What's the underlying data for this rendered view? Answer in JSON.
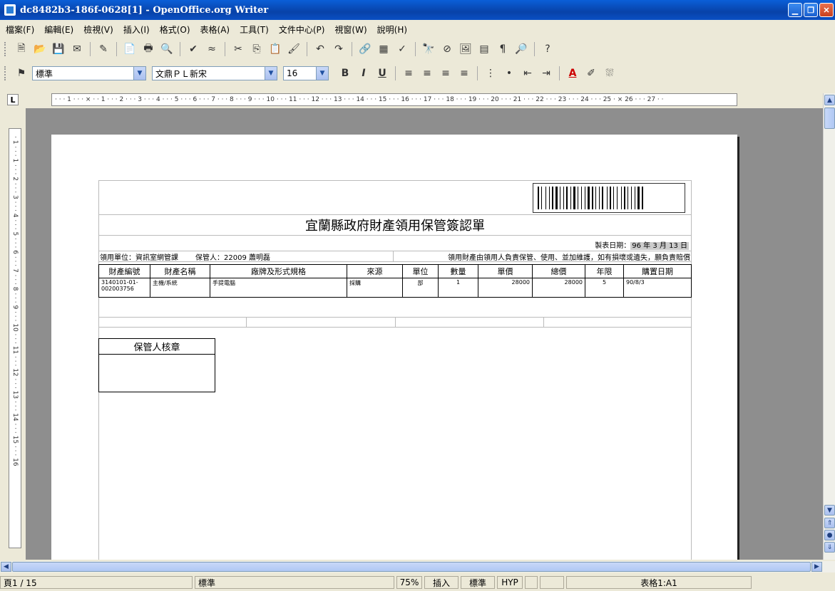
{
  "window": {
    "title": "dc8482b3-186f-0628[1] - OpenOffice.org Writer",
    "controls": [
      "minimize",
      "maximize",
      "close"
    ]
  },
  "menu": [
    "檔案(F)",
    "編輯(E)",
    "檢視(V)",
    "插入(I)",
    "格式(O)",
    "表格(A)",
    "工具(T)",
    "文件中心(P)",
    "視窗(W)",
    "說明(H)"
  ],
  "formatting": {
    "style": "標準",
    "font": "文鼎ＰＬ新宋",
    "size": "16"
  },
  "ruler": {
    "horizontal": "· · · 1 · · · ⨯ · · 1 · · · 2 · · · 3 · · · 4 · · · 5 · · · 6 · · · 7 · · · 8 · · · 9 · · · 10 · · · 11 · · · 12 · · · 13 · · · 14 · · · 15 · · · 16 · · · 17 · · · 18 · · · 19 · · · 20 · · · 21 · · · 22 · · · 23 · · · 24 · · · 25 · ⨯ 26 · · · 27 · ·",
    "vertical": "· 1 · · · 1 · · · 2 · · · 3 · · · 4 · · · 5 · · · 6 · · · 7 · · · 8 · · · 9 · · · 10 · · · 11 · · · 12 · · · 13 · · · 14 · · · 15 · · · 16",
    "corner": "L"
  },
  "document": {
    "title": "宜蘭縣政府財產領用保管簽認單",
    "date_label": "製表日期：",
    "date_value": "96 年 3 月 13 日",
    "unit_label": "領用單位：資訊室網管課",
    "keeper_label": "保管人：22009 蕭明磊",
    "notice": "領用財產由領用人負責保管、使用、並加維護，如有損壞或遺失，願負責賠償",
    "columns": [
      "財產編號",
      "財產名稱",
      "廠牌及形式規格",
      "來源",
      "單位",
      "數量",
      "單價",
      "總價",
      "年限",
      "購置日期"
    ],
    "rows": [
      [
        "3140101-01-002003756",
        "主機/系統",
        "手提電腦",
        "採購",
        "部",
        "1",
        "28000",
        "28000",
        "5",
        "90/8/3"
      ]
    ],
    "sign_header": "保管人核章"
  },
  "status": {
    "page": "頁1 / 15",
    "style": "標準",
    "zoom": "75%",
    "insert": "插入",
    "selection": "標準",
    "hyp": "HYP",
    "cell": "表格1:A1"
  }
}
